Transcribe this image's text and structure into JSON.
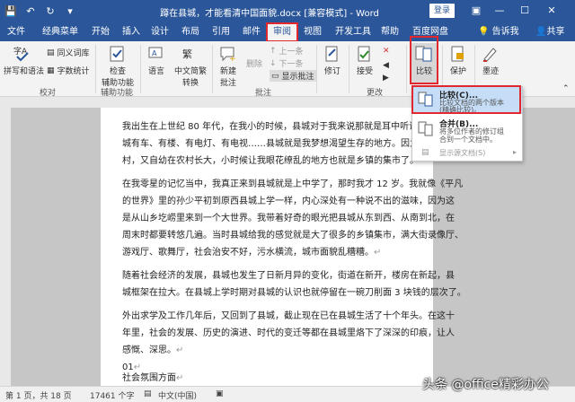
{
  "titlebar": {
    "title": "蹲在县城，才能看清中国面貌.docx [兼容模式] - Word",
    "login": "登录",
    "accent": "#2b579a"
  },
  "menu": {
    "tabs": [
      "文件",
      "经典菜单",
      "开始",
      "插入",
      "设计",
      "布局",
      "引用",
      "邮件",
      "审阅",
      "视图",
      "开发工具",
      "帮助",
      "百度网盘"
    ],
    "active": "审阅",
    "tell_me": "告诉我",
    "share": "共享"
  },
  "ribbon": {
    "spelling": "拼写和语法",
    "thesaurus": "同义词库",
    "word_count": "字数统计",
    "group_proofing": "校对",
    "check_access_1": "检查",
    "check_access_2": "辅助功能",
    "group_access": "辅助功能",
    "language": "语言",
    "chinese_convert_1": "中文简繁",
    "chinese_convert_2": "转换",
    "new_comment_1": "新建",
    "new_comment_2": "批注",
    "delete": "删除",
    "prev": "上一条",
    "next": "下一条",
    "show_comments": "显示批注",
    "group_comments": "批注",
    "track": "修订",
    "accept": "接受",
    "group_changes": "更改",
    "compare": "比较",
    "protect": "保护",
    "ink": "墨迹",
    "highlight_color": "#e0282e"
  },
  "dropdown": {
    "compare_title": "比较(C)...",
    "compare_desc_1": "比较文档的两个版本",
    "compare_desc_2": "(精确比较)。",
    "combine_title": "合并(B)...",
    "combine_desc_1": "将多位作者的修订组",
    "combine_desc_2": "合到一个文档中。",
    "show_source": "显示源文档(S)"
  },
  "document": {
    "lines": [
      "我出生在上世纪 80 年代，在我小的时候，县城对于我来说那就是耳中听说",
      "城有车、有楼、有电灯、有电视……县城就是我梦想渴望生存的地方。因为",
      "村，又自幼在农村长大，小时候让我眼花缭乱的地方也就是乡镇的集市了。",
      "在我零星的记忆当中，我真正来到县城就是上中学了，那时我才 12 岁。我就像《平凡",
      "的世界》里的孙少平初到原西县城上学一样，内心深处有一种说不出的滋味，因为这",
      "是从山乡圪崂里来到一个大世界。我带着好奇的眼光把县城从东到西、从南到北，在",
      "周末时都要转悠几遍。当时县城给我的感觉就是大了很多的乡镇集市，满大街录像厅、",
      "游戏厅、歌舞厅，社会治安不好，污水横流，城市面貌乱糟糟。",
      "随着社会经济的发展，县城也发生了日新月异的变化，街道在新开，楼房在新起，县",
      "城框架在拉大。在县城上学时期对县城的认识也就停留在一碗刀削面 3 块钱的层次了。",
      "外出求学及工作几年后，又回到了县城，截止现在已在县城生活了十个年头。在这十",
      "年里，社会的发展、历史的演进、时代的变迁等都在县城里烙下了深深的印痕，让人",
      "感慨、深思。",
      "01",
      "社会氛围方面"
    ],
    "para_mark": "↵"
  },
  "status": {
    "page": "第 1 页，共 18 页",
    "words": "17461 个字",
    "lang": "中文(中国)"
  },
  "watermark": "头条 @office精彩办公"
}
